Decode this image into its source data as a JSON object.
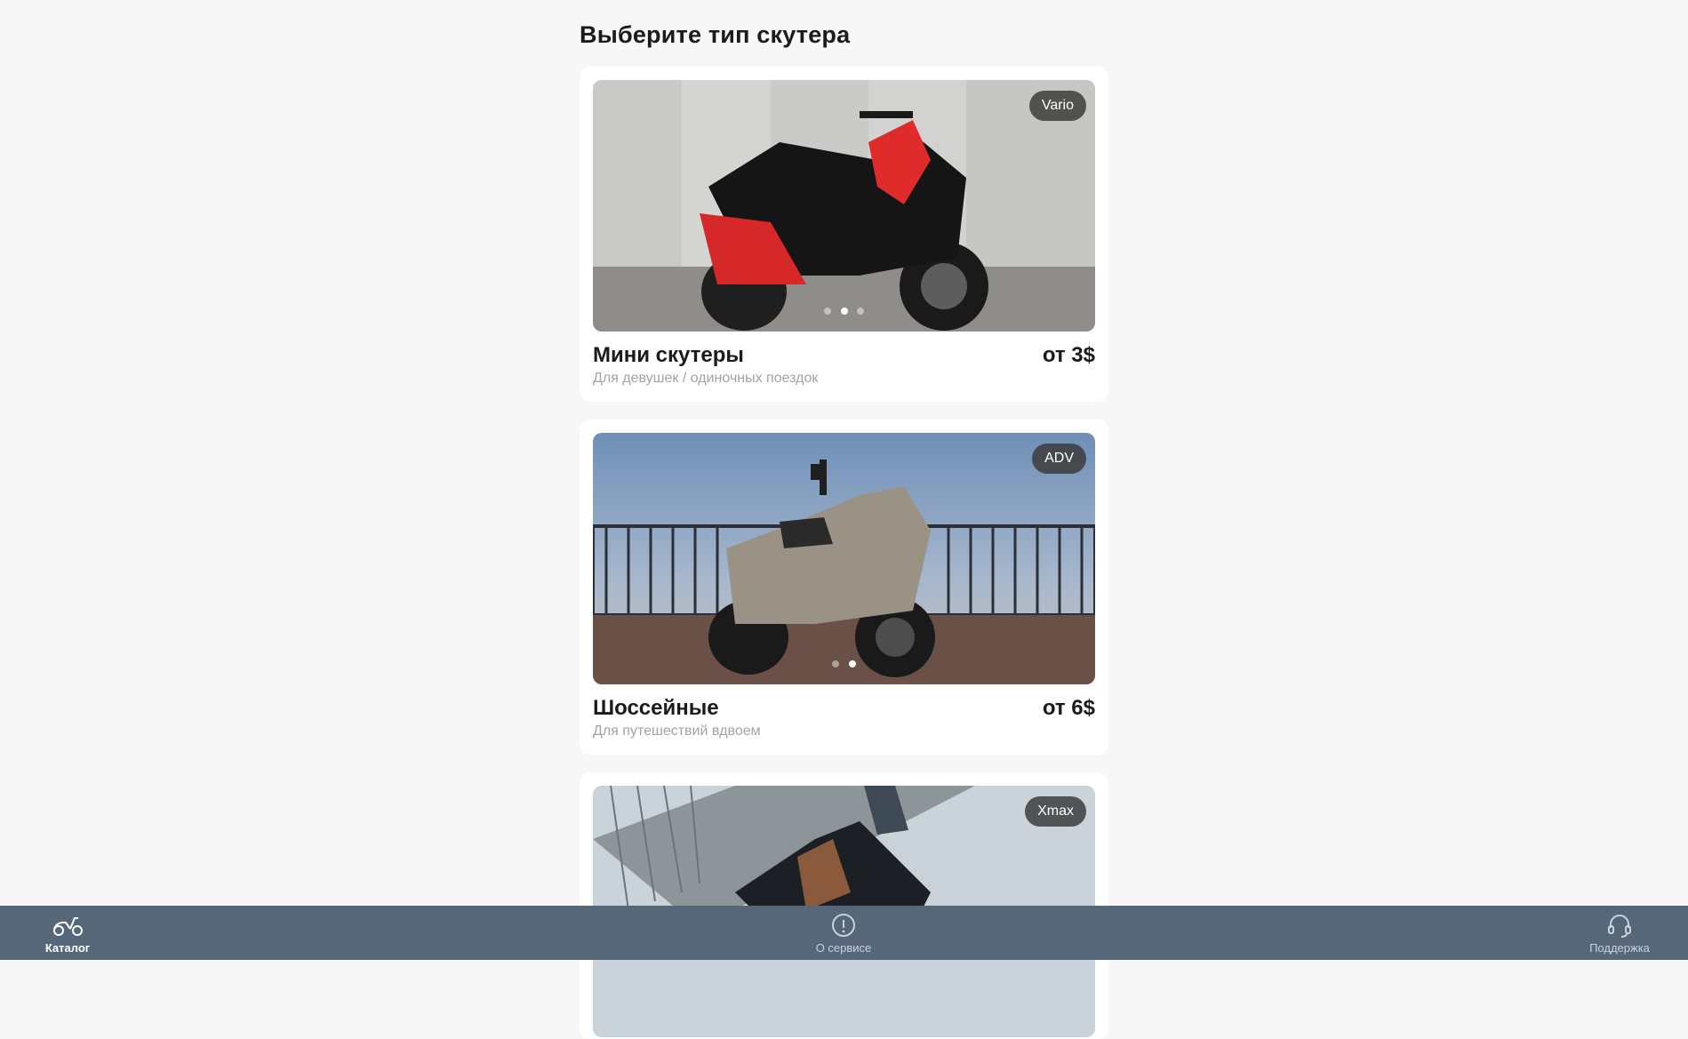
{
  "page": {
    "title": "Выберите тип скутера"
  },
  "cards": [
    {
      "badge": "Vario",
      "name": "Мини скутеры",
      "price": "от 3$",
      "description": "Для девушек / одиночных поездок"
    },
    {
      "badge": "ADV",
      "name": "Шоссейные",
      "price": "от 6$",
      "description": "Для путешествий вдвоем"
    },
    {
      "badge": "Xmax",
      "name": "",
      "price": "",
      "description": ""
    }
  ],
  "navbar": {
    "items": [
      {
        "label": "Каталог",
        "icon": "scooter-icon",
        "active": true
      },
      {
        "label": "О сервисе",
        "icon": "info-icon",
        "active": false
      },
      {
        "label": "Поддержка",
        "icon": "headset-icon",
        "active": false
      }
    ]
  },
  "colors": {
    "background": "#f7f7f7",
    "card": "#ffffff",
    "navbar": "#56677a",
    "accent_red": "#e02b2b"
  }
}
